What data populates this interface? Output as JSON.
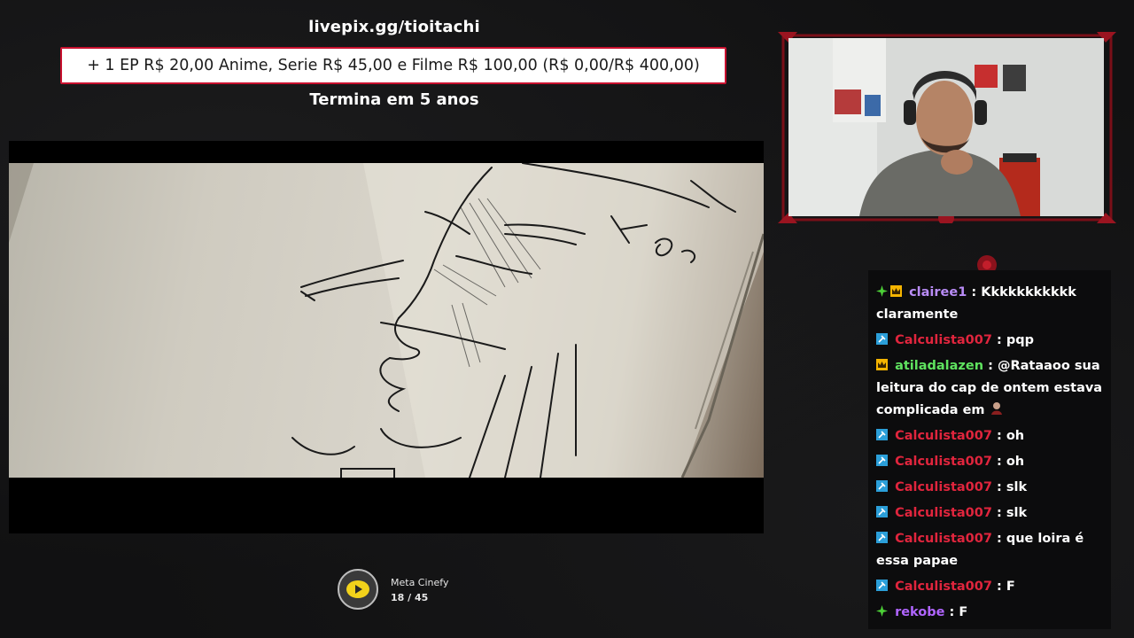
{
  "goal": {
    "url": "livepix.gg/tioitachi",
    "text": "+ 1 EP R$ 20,00 Anime, Serie R$ 45,00 e Filme R$ 100,00 (R$ 0,00/R$ 400,00)",
    "ends": "Termina em 5 anos"
  },
  "meta": {
    "title": "Meta Cinefy",
    "progress": "18 / 45"
  },
  "chat": {
    "messages": [
      {
        "badges": [
          "plus-badge",
          "crown-badge"
        ],
        "user": "clairee1",
        "color": "#b98cf6",
        "text": ": Kkkkkkkkkkk claramente"
      },
      {
        "badges": [
          "pin-badge"
        ],
        "user": "Calculista007",
        "color": "#e0253d",
        "text": ": pqp"
      },
      {
        "badges": [
          "crown-badge"
        ],
        "user": "atiladalazen",
        "color": "#5fe35f",
        "text": ": @Rataaoo sua leitura do cap de ontem estava complicada em"
      },
      {
        "badges": [
          "pin-badge"
        ],
        "user": "Calculista007",
        "color": "#e0253d",
        "text": ": oh"
      },
      {
        "badges": [
          "pin-badge"
        ],
        "user": "Calculista007",
        "color": "#e0253d",
        "text": ": oh"
      },
      {
        "badges": [
          "pin-badge"
        ],
        "user": "Calculista007",
        "color": "#e0253d",
        "text": ": slk"
      },
      {
        "badges": [
          "pin-badge"
        ],
        "user": "Calculista007",
        "color": "#e0253d",
        "text": ": slk"
      },
      {
        "badges": [
          "pin-badge"
        ],
        "user": "Calculista007",
        "color": "#e0253d",
        "text": ": que loira é essa papae"
      },
      {
        "badges": [
          "pin-badge"
        ],
        "user": "Calculista007",
        "color": "#e0253d",
        "text": ": F"
      },
      {
        "badges": [
          "plus-badge"
        ],
        "user": "rekobe",
        "color": "#b065ff",
        "text": ": F"
      }
    ]
  },
  "colors": {
    "accent": "#c8102e",
    "badge_plus": "#4cd137",
    "badge_crown": "#f5b400",
    "badge_pin": "#2b9fd9"
  }
}
